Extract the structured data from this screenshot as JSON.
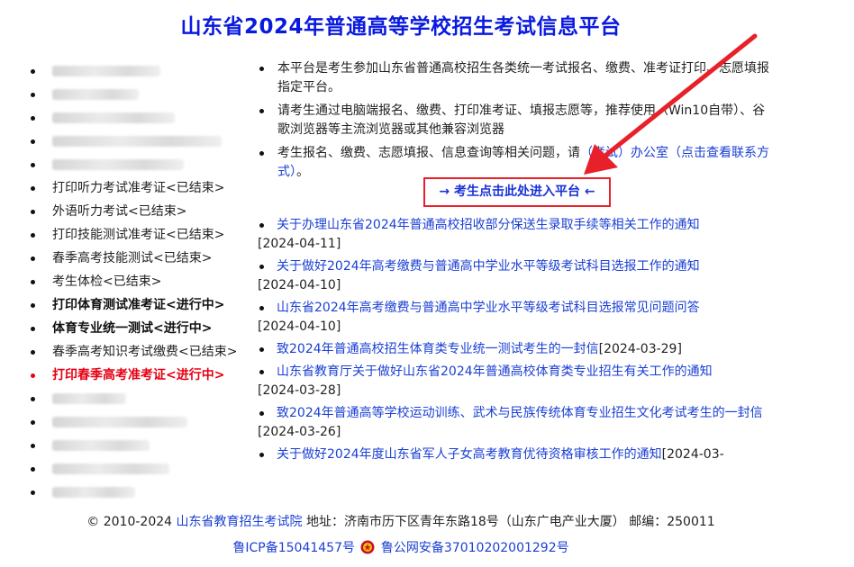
{
  "header": {
    "title": "山东省2024年普通高等学校招生考试信息平台"
  },
  "sidebar": {
    "items": [
      {
        "label": "",
        "state": "blurred"
      },
      {
        "label": "",
        "state": "blurred"
      },
      {
        "label": "",
        "state": "blurred"
      },
      {
        "label": "",
        "state": "blurred"
      },
      {
        "label": "",
        "state": "blurred"
      },
      {
        "label": "打印听力考试准考证<已结束>",
        "state": "normal"
      },
      {
        "label": "外语听力考试<已结束>",
        "state": "normal"
      },
      {
        "label": "打印技能测试准考证<已结束>",
        "state": "normal"
      },
      {
        "label": "春季高考技能测试<已结束>",
        "state": "normal"
      },
      {
        "label": "考生体检<已结束>",
        "state": "normal"
      },
      {
        "label": "打印体育测试准考证<进行中>",
        "state": "bold"
      },
      {
        "label": "体育专业统一测试<进行中>",
        "state": "bold"
      },
      {
        "label": "春季高考知识考试缴费<已结束>",
        "state": "normal"
      },
      {
        "label": "打印春季高考准考证<进行中>",
        "state": "active-red"
      },
      {
        "label": "",
        "state": "blurred"
      },
      {
        "label": "",
        "state": "blurred"
      },
      {
        "label": "",
        "state": "blurred"
      },
      {
        "label": "",
        "state": "blurred"
      },
      {
        "label": "",
        "state": "blurred"
      }
    ]
  },
  "notes": {
    "note1": "本平台是考生参加山东省普通高校招生各类统一考试报名、缴费、准考证打印、志愿填报指定平台。",
    "note2": "请考生通过电脑端报名、缴费、打印准考证、填报志愿等，推荐使用（Win10自带）、谷歌浏览器等主流浏览器或其他兼容浏览器",
    "note3_text": "考生报名、缴费、志愿填报、信息查询等相关问题，请",
    "note3_link": "（考试）办公室（点击查看联系方式）",
    "note3_end": "。"
  },
  "enter_button": {
    "label": "→ 考生点击此处进入平台 ←"
  },
  "news": [
    {
      "title": "关于办理山东省2024年普通高校招收部分保送生录取手续等相关工作的通知",
      "date": "[2024-04-11]"
    },
    {
      "title": "关于做好2024年高考缴费与普通高中学业水平等级考试科目选报工作的通知",
      "date": "[2024-04-10]"
    },
    {
      "title": "山东省2024年高考缴费与普通高中学业水平等级考试科目选报常见问题问答",
      "date": "[2024-04-10]"
    },
    {
      "title": "致2024年普通高校招生体育类专业统一测试考生的一封信",
      "date": "[2024-03-29]"
    },
    {
      "title": "山东省教育厅关于做好山东省2024年普通高校体育类专业招生有关工作的通知",
      "date": "[2024-03-28]"
    },
    {
      "title": "致2024年普通高等学校运动训练、武术与民族传统体育专业招生文化考试考生的一封信",
      "date": "[2024-03-26]"
    },
    {
      "title": "关于做好2024年度山东省军人子女高考教育优待资格审核工作的通知",
      "date": "[2024-03-"
    }
  ],
  "footer": {
    "copyright": "© 2010-2024",
    "org": "山东省教育招生考试院",
    "address": "地址：济南市历下区青年东路18号（山东广电产业大厦） 邮编：250011",
    "icp": "鲁ICP备15041457号",
    "police": "鲁公网安备37010202001292号"
  },
  "colors": {
    "title_blue": "#0a1adf",
    "link_blue": "#1a3fd4",
    "active_red": "#e60012",
    "annotation_red": "#e8202a"
  },
  "icons": {
    "police_badge": "police-badge-icon",
    "annotation_arrow": "red-arrow-icon"
  }
}
